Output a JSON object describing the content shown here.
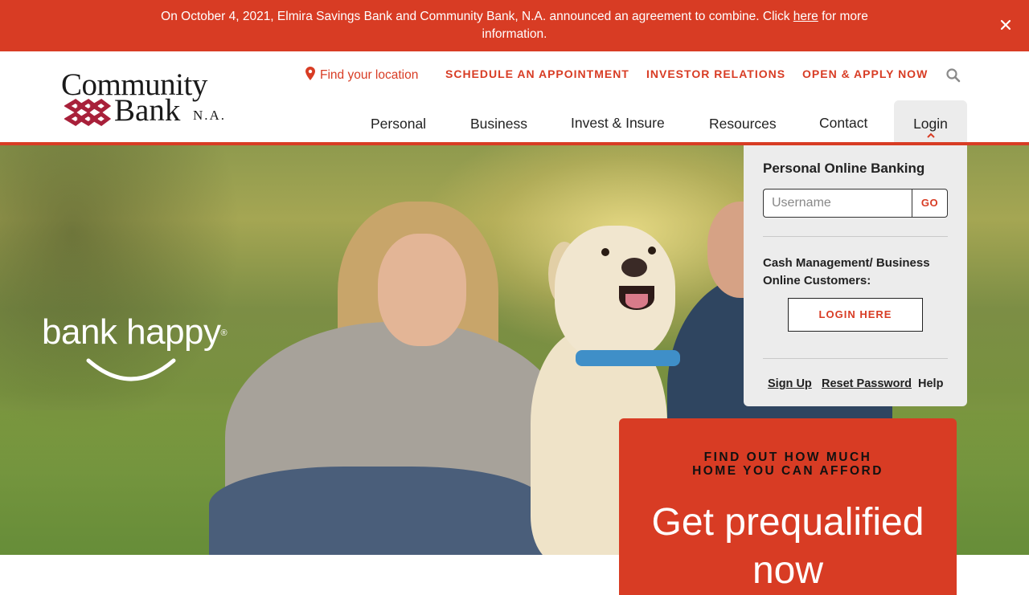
{
  "announcement": {
    "text_before": "On October 4, 2021, Elmira Savings Bank and Community Bank, N.A. announced an agreement to combine. Click ",
    "link_label": "here",
    "text_after": " for more information.",
    "close_icon": "close-icon"
  },
  "logo": {
    "line1": "Community",
    "line2": "Bank",
    "suffix": "N.A."
  },
  "utility_nav": {
    "location_label": "Find your location",
    "location_icon": "map-pin-icon",
    "schedule_label": "SCHEDULE AN APPOINTMENT",
    "investor_label": "INVESTOR RELATIONS",
    "apply_label": "OPEN & APPLY NOW",
    "search_icon": "search-icon"
  },
  "main_nav": {
    "items": [
      "Personal",
      "Business",
      "Invest & Insure",
      "Resources",
      "Contact"
    ],
    "login_label": "Login"
  },
  "hero": {
    "tagline": "bank happy",
    "tagline_mark": "®"
  },
  "login_panel": {
    "title": "Personal Online Banking",
    "username_placeholder": "Username",
    "go_label": "GO",
    "cash_mgmt_text": "Cash Management/ Business Online Customers:",
    "login_here_label": "LOGIN HERE",
    "links": [
      "Sign Up",
      "Reset Password",
      "Help"
    ]
  },
  "promo": {
    "eyebrow_line1": "FIND OUT HOW MUCH",
    "eyebrow_line2": "HOME YOU CAN AFFORD",
    "headline_line1": "Get prequalified",
    "headline_line2": "now"
  },
  "colors": {
    "brand_red": "#d83c24",
    "logo_mark_red": "#a8203a",
    "panel_gray": "#ececec"
  }
}
